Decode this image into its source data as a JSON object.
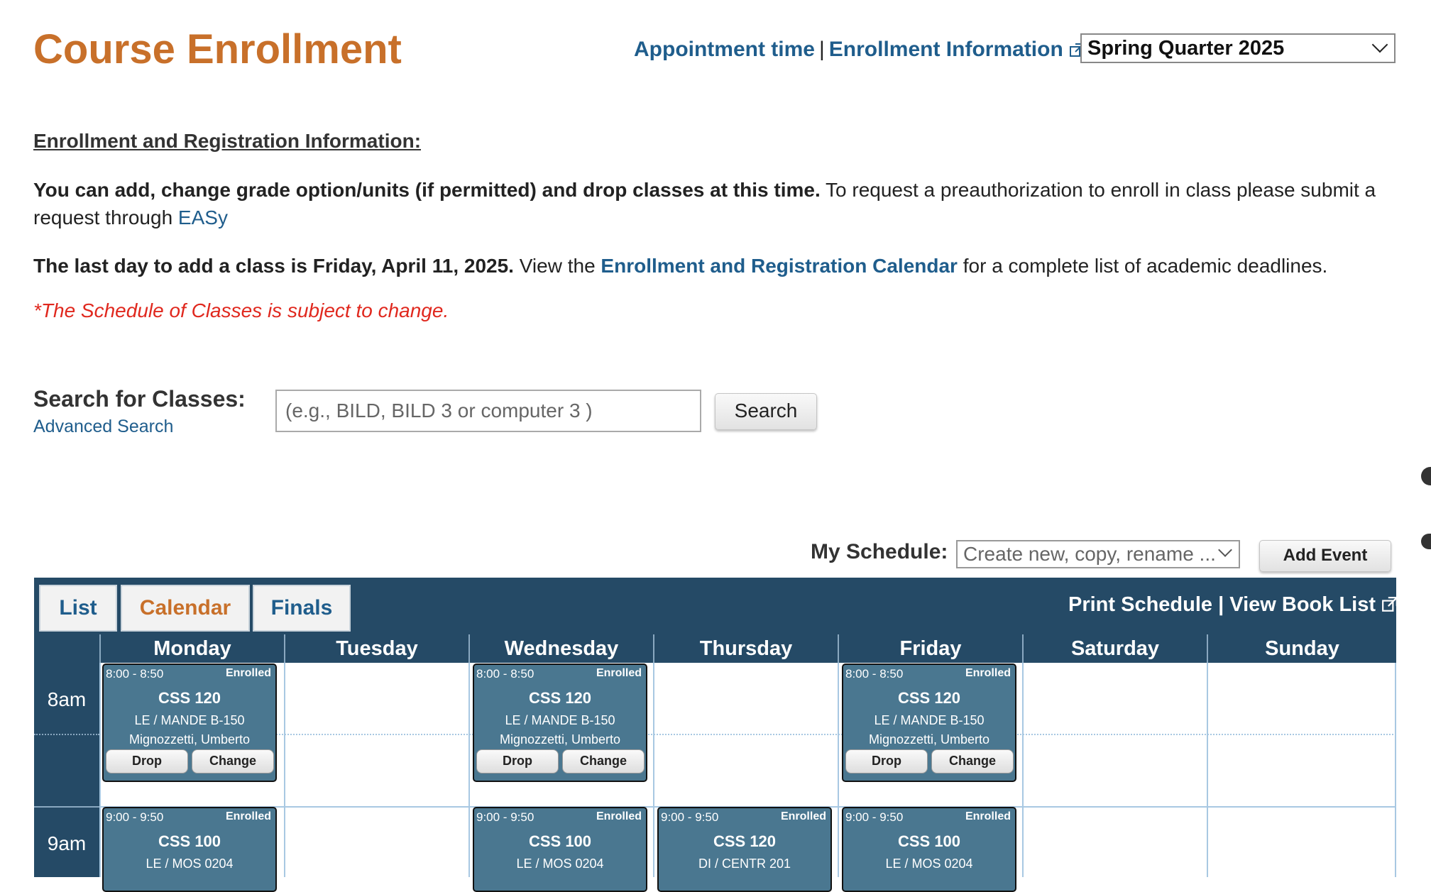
{
  "header": {
    "title": "Course Enrollment",
    "appointment_link": "Appointment time",
    "separator": "|",
    "enrollment_info_link": "Enrollment Information",
    "term_selected": "Spring Quarter 2025"
  },
  "info": {
    "heading": "Enrollment and Registration Information:",
    "para1_bold": "You can add, change grade option/units (if permitted) and drop classes at this time.",
    "para1_text": " To request a preauthorization to enroll in class please submit a request through ",
    "para1_link": "EASy",
    "para2_bold": "The last day to add a class is Friday, April 11, 2025.",
    "para2_pre": " View the ",
    "para2_link": "Enrollment and Registration Calendar",
    "para2_post": " for a complete list of academic deadlines.",
    "notice": "*The Schedule of Classes is subject to change."
  },
  "search": {
    "label": "Search for Classes:",
    "advanced_link": "Advanced Search",
    "placeholder": "(e.g., BILD, BILD 3 or computer 3 )",
    "button": "Search"
  },
  "schedule": {
    "label": "My Schedule:",
    "select_placeholder": "Create new, copy, rename ...",
    "add_event": "Add Event"
  },
  "calendar": {
    "tabs": [
      "List",
      "Calendar",
      "Finals"
    ],
    "active_tab": "Calendar",
    "print_links": "Print Schedule | View Book List",
    "days": [
      "Monday",
      "Tuesday",
      "Wednesday",
      "Thursday",
      "Friday",
      "Saturday",
      "Sunday"
    ],
    "times": [
      "8am",
      "9am"
    ],
    "events": {
      "mon_8": {
        "time": "8:00 - 8:50",
        "status": "Enrolled",
        "course": "CSS 120",
        "location": "LE / MANDE B-150",
        "instructor": "Mignozzetti, Umberto",
        "drop": "Drop",
        "change": "Change"
      },
      "wed_8": {
        "time": "8:00 - 8:50",
        "status": "Enrolled",
        "course": "CSS 120",
        "location": "LE / MANDE B-150",
        "instructor": "Mignozzetti, Umberto",
        "drop": "Drop",
        "change": "Change"
      },
      "fri_8": {
        "time": "8:00 - 8:50",
        "status": "Enrolled",
        "course": "CSS 120",
        "location": "LE / MANDE B-150",
        "instructor": "Mignozzetti, Umberto",
        "drop": "Drop",
        "change": "Change"
      },
      "mon_9": {
        "time": "9:00 - 9:50",
        "status": "Enrolled",
        "course": "CSS 100",
        "location": "LE / MOS 0204"
      },
      "wed_9": {
        "time": "9:00 - 9:50",
        "status": "Enrolled",
        "course": "CSS 100",
        "location": "LE / MOS 0204"
      },
      "thu_9": {
        "time": "9:00 - 9:50",
        "status": "Enrolled",
        "course": "CSS 120",
        "location": "DI / CENTR 201"
      },
      "fri_9": {
        "time": "9:00 - 9:50",
        "status": "Enrolled",
        "course": "CSS 100",
        "location": "LE / MOS 0204"
      }
    }
  },
  "colors": {
    "title_orange": "#c8702a",
    "link_blue": "#1f5d8c",
    "notice_red": "#e0281e",
    "calendar_navy": "#254a66",
    "event_blue": "#4a7790"
  },
  "icons": [
    "external-link-icon",
    "chevron-down-icon"
  ]
}
